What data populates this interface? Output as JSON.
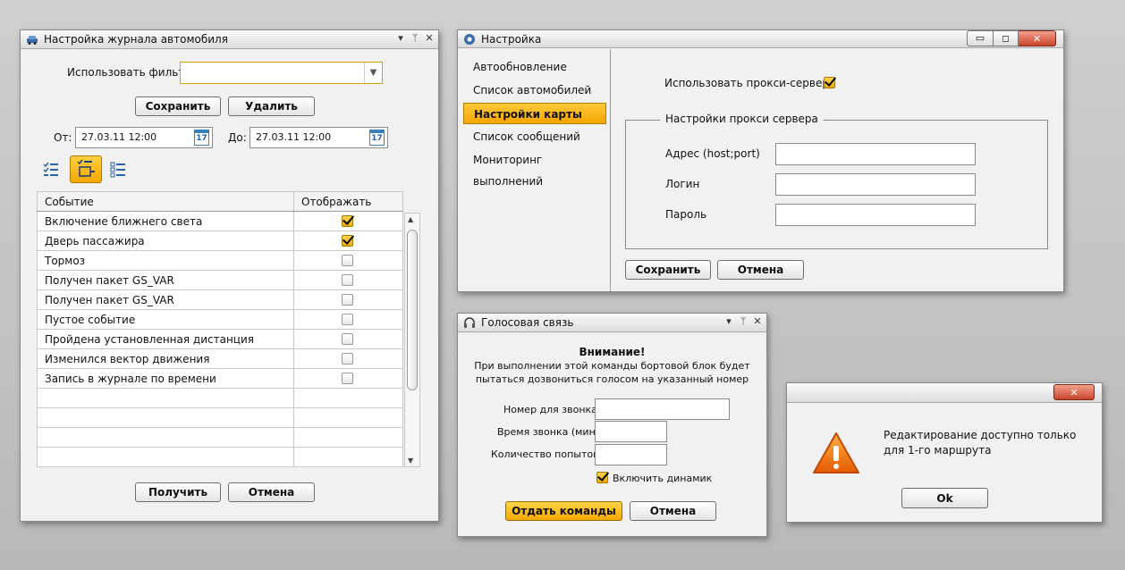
{
  "journal": {
    "title": "Настройка журнала автомобиля",
    "filter_label": "Использовать фильтр:",
    "filter_value": "",
    "save_label": "Сохранить",
    "delete_label": "Удалить",
    "from_label": "От:",
    "from_value": "27.03.11 12:00",
    "to_label": "До:",
    "to_value": "27.03.11 12:00",
    "cal_day": "17",
    "col_event": "Событие",
    "col_show": "Отображать",
    "rows": [
      {
        "event": "Включение ближнего света",
        "checked": true
      },
      {
        "event": "Дверь пассажира",
        "checked": true
      },
      {
        "event": "Тормоз",
        "checked": false
      },
      {
        "event": "Получен пакет GS_VAR",
        "checked": false
      },
      {
        "event": "Получен пакет GS_VAR",
        "checked": false
      },
      {
        "event": "Пустое событие",
        "checked": false
      },
      {
        "event": "Пройдена установленная дистанция",
        "checked": false
      },
      {
        "event": "Изменился вектор движения",
        "checked": false
      },
      {
        "event": "Запись в журнале по времени",
        "checked": false
      }
    ],
    "get_label": "Получить",
    "cancel_label": "Отмена"
  },
  "settings": {
    "title": "Настройка",
    "nav": [
      "Автообновление",
      "Список автомобилей",
      "Настройки карты",
      "Список сообщений",
      "Мониторинг выполнений"
    ],
    "selected_nav": "Настройки карты",
    "use_proxy_label": "Использовать прокси-сервер",
    "use_proxy_checked": true,
    "group_title": "Настройки прокси сервера",
    "address_label": "Адрес (host;port)",
    "login_label": "Логин",
    "password_label": "Пароль",
    "address_value": "",
    "login_value": "",
    "password_value": "",
    "save_label": "Сохранить",
    "cancel_label": "Отмена"
  },
  "voice": {
    "title": "Голосовая связь",
    "warning_title": "Внимание!",
    "warning_line1": "При выполнении этой команды бортовой блок будет",
    "warning_line2": "пытаться дозвониться голосом на указанный номер",
    "number_label": "Номер для звонка:",
    "duration_label": "Время звонка (мин):",
    "attempts_label": "Количество попыток:",
    "number_value": "",
    "duration_value": "",
    "attempts_value": "",
    "speaker_label": "Включить динамик",
    "speaker_checked": true,
    "send_label": "Отдать команды",
    "cancel_label": "Отмена"
  },
  "alert": {
    "line1": "Редактирование доступно только",
    "line2": "для 1-го маршрута",
    "ok_label": "Ok"
  },
  "colors": {
    "accent": "#f5a800",
    "warning": "#f07000"
  }
}
